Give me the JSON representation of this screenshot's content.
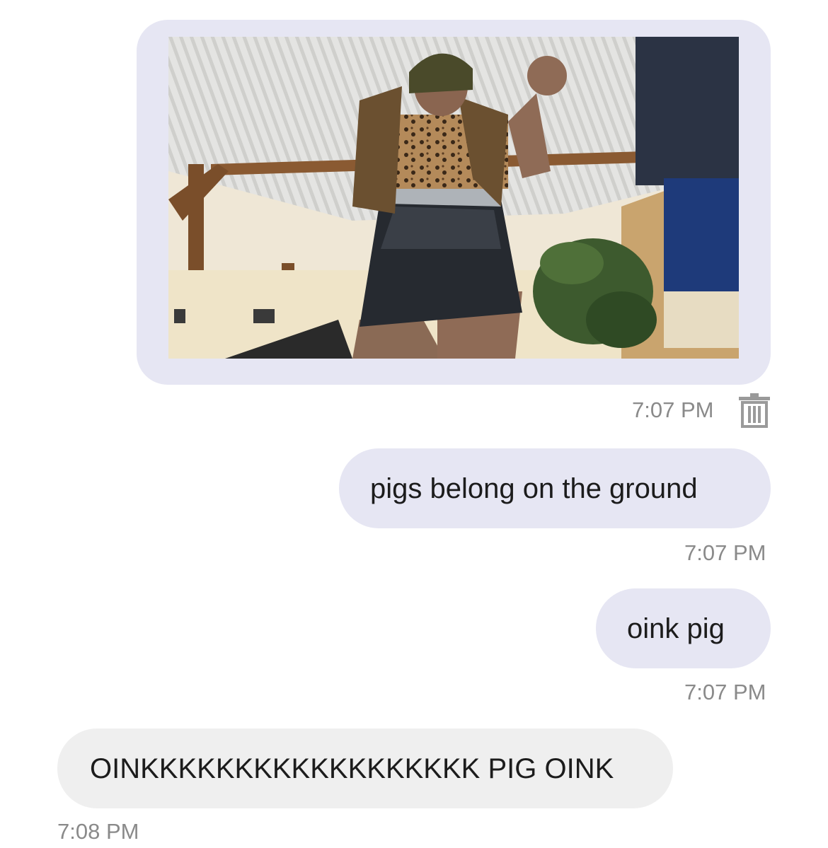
{
  "messages": [
    {
      "type": "image",
      "direction": "outgoing",
      "image_alt": "photo",
      "time": "7:07 PM",
      "delete_icon": "trash-icon"
    },
    {
      "type": "text",
      "direction": "outgoing",
      "text": "pigs belong on the ground",
      "time": "7:07 PM"
    },
    {
      "type": "text",
      "direction": "outgoing",
      "text": "oink pig",
      "time": "7:07 PM"
    },
    {
      "type": "text",
      "direction": "incoming",
      "text": "OINKKKKKKKKKKKKKKKKKK PIG OINK",
      "time": "7:08 PM"
    }
  ],
  "colors": {
    "outgoing_bubble": "#e6e6f3",
    "incoming_bubble": "#efefef",
    "timestamp": "#8a8a8a",
    "message_text": "#1c1c1c"
  }
}
